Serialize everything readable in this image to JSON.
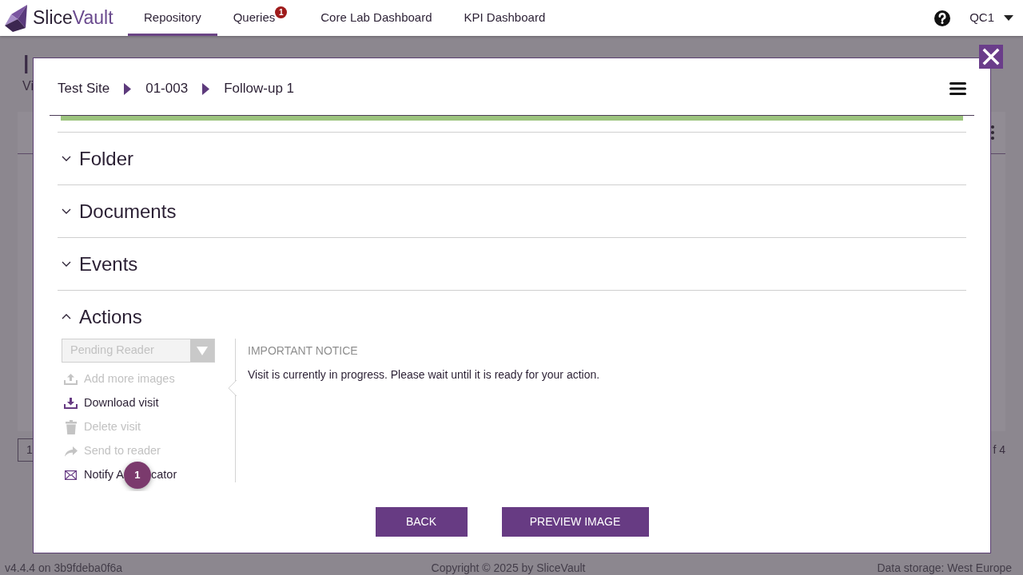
{
  "navbar": {
    "brand_parts": [
      "Slice",
      "Vault"
    ],
    "tabs": [
      {
        "label": "Repository",
        "selected": true
      },
      {
        "label": "Queries",
        "selected": false,
        "badge": "1"
      },
      {
        "label": "Core Lab Dashboard",
        "selected": false
      },
      {
        "label": "KPI Dashboard",
        "selected": false
      }
    ],
    "user_menu": "QC1"
  },
  "page": {
    "title": "I",
    "subtitle": "Vi",
    "pagination": {
      "current_page": "1",
      "page_total_fragment": "f 4"
    }
  },
  "modal": {
    "breadcrumb": [
      "Test Site",
      "01-003",
      "Follow-up 1"
    ],
    "sections": [
      {
        "title": "Folder",
        "expanded": false
      },
      {
        "title": "Documents",
        "expanded": false
      },
      {
        "title": "Events",
        "expanded": false
      },
      {
        "title": "Actions",
        "expanded": true,
        "status_select": {
          "value": "Pending Reader",
          "disabled": true
        },
        "items": [
          {
            "label": "Add more images",
            "disabled": true
          },
          {
            "label": "Download visit",
            "disabled": false
          },
          {
            "label": "Delete visit",
            "disabled": true
          },
          {
            "label": "Send to reader",
            "disabled": true
          },
          {
            "label": "Notify A",
            "label_after_marker": "cator",
            "step_marker": "1",
            "disabled": false
          }
        ],
        "notice": {
          "heading": "IMPORTANT NOTICE",
          "text": "Visit is currently in progress. Please wait until it is ready for your action."
        }
      }
    ],
    "buttons": [
      "BACK",
      "PREVIEW IMAGE"
    ]
  },
  "footer": {
    "version": "v4.4.4 on 3b9fdeba0f6a",
    "copyright": "Copyright © 2025 by SliceVault",
    "data_storage": "Data storage: West Europe"
  }
}
